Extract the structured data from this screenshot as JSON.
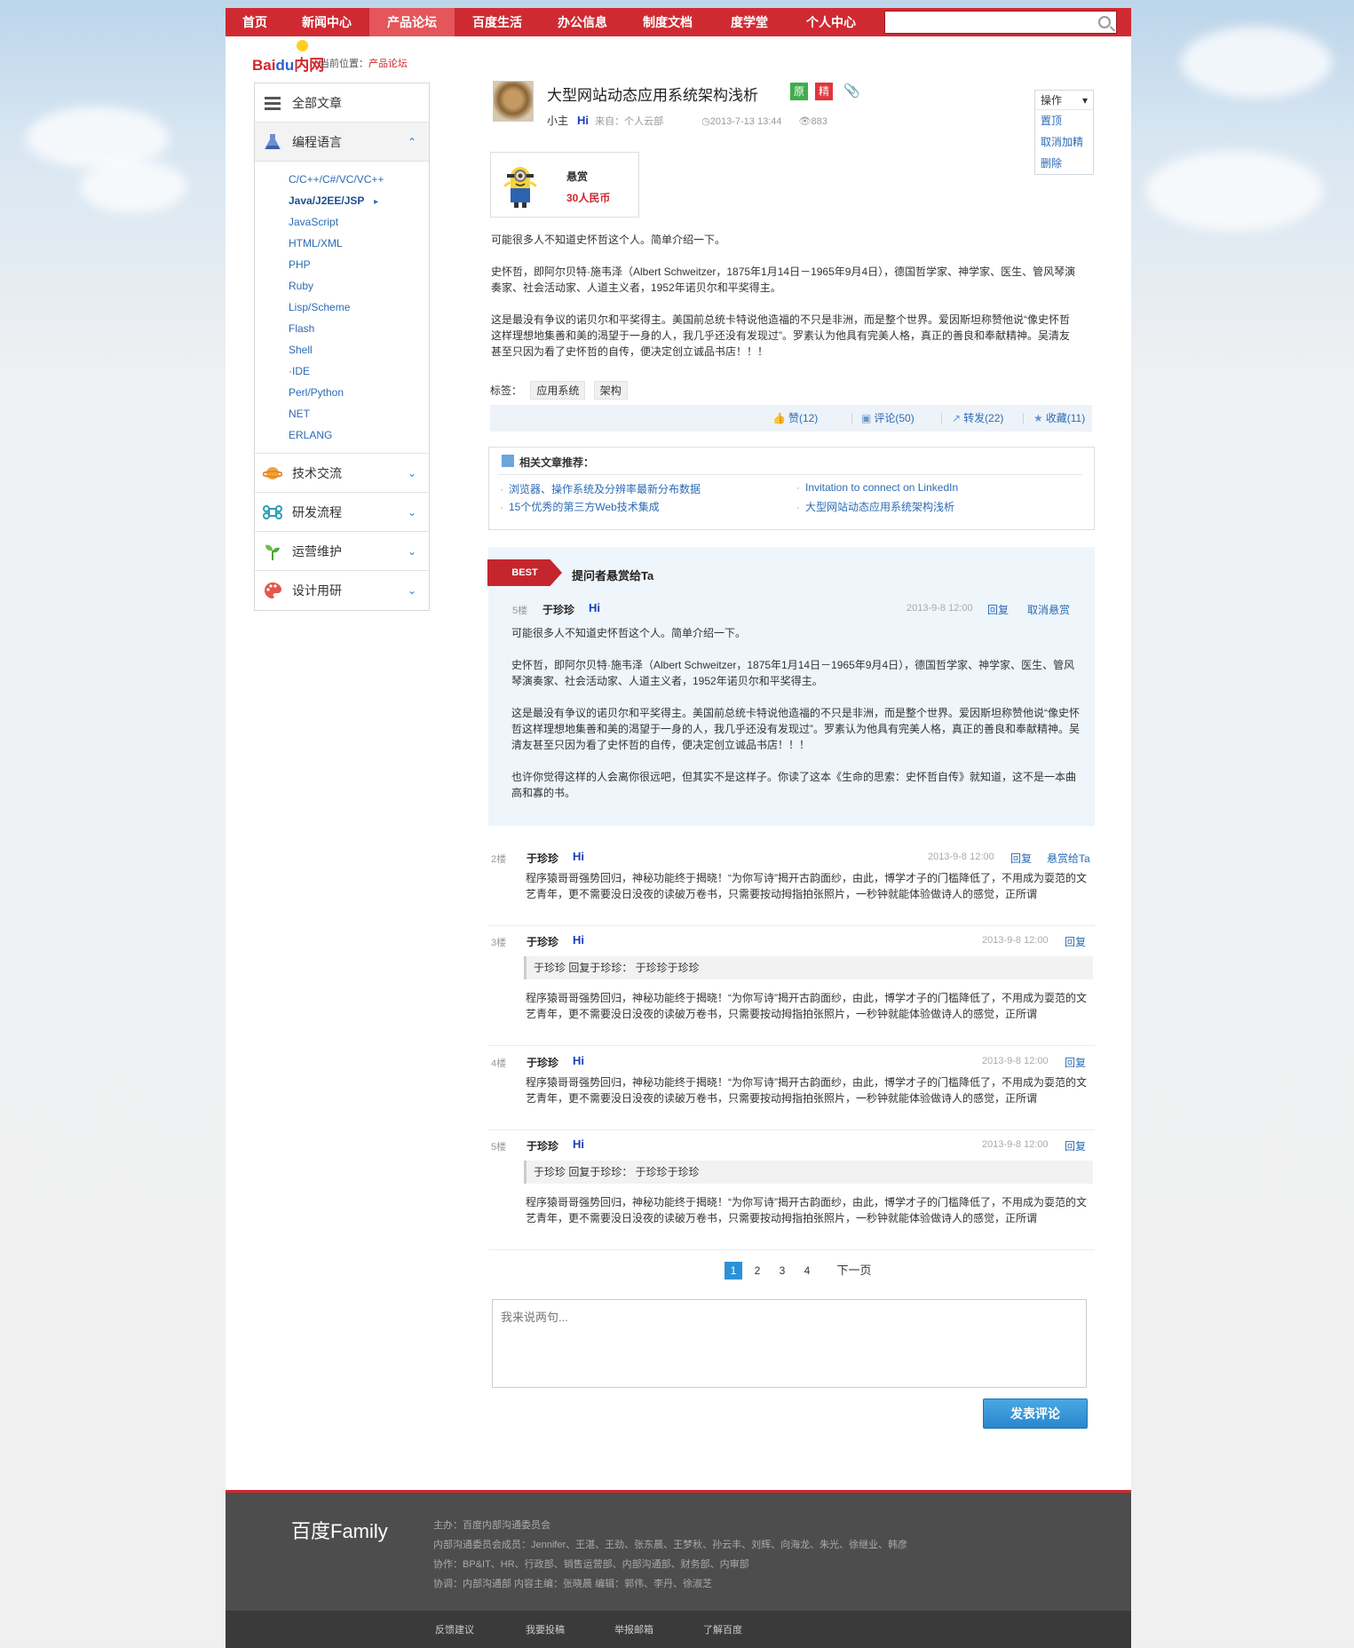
{
  "nav": {
    "items": [
      "首页",
      "新闻中心",
      "产品论坛",
      "百度生活",
      "办公信息",
      "制度文档",
      "度学堂",
      "个人中心"
    ],
    "active": "产品论坛",
    "search_value": ""
  },
  "logo": {
    "part1": "Bai",
    "part2": "du",
    "part3": "内网"
  },
  "breadcrumb": {
    "label": "当前位置：",
    "current": "产品论坛"
  },
  "sidebar": {
    "all": "全部文章",
    "lang": "编程语言",
    "lang_items": [
      "C/C++/C#/VC/VC++",
      "Java/J2EE/JSP",
      "JavaScript",
      "HTML/XML",
      "PHP",
      "Ruby",
      "Lisp/Scheme",
      "Flash",
      "Shell",
      "·IDE",
      "Perl/Python",
      "NET",
      "ERLANG"
    ],
    "selected": "Java/J2EE/JSP",
    "tech": "技术交流",
    "flow": "研发流程",
    "ops": "运营维护",
    "design": "设计用研"
  },
  "article": {
    "title": "大型网站动态应用系统架构浅析",
    "badge_original": "原",
    "badge_featured": "精",
    "author": "小主",
    "hi": "Hi",
    "source": "来自：个人云部",
    "time": "2013-7-13 13:44",
    "views": "883",
    "reward_label": "悬赏",
    "reward_value": "30人民币",
    "p1": "可能很多人不知道史怀哲这个人。简单介绍一下。",
    "p2": "史怀哲，即阿尔贝特·施韦泽（Albert Schweitzer，1875年1月14日－1965年9月4日），德国哲学家、神学家、医生、管风琴演奏家、社会活动家、人道主义者，1952年诺贝尔和平奖得主。",
    "p3": "这是最没有争议的诺贝尔和平奖得主。美国前总统卡特说他造福的不只是非洲，而是整个世界。爱因斯坦称赞他说“像史怀哲这样理想地集善和美的渴望于一身的人，我几乎还没有发现过”。罗素认为他具有完美人格，真正的善良和奉献精神。吴清友甚至只因为看了史怀哲的自传，便决定创立诚品书店！！！",
    "tags_label": "标签：",
    "tags": [
      "应用系统",
      "架构"
    ],
    "like": "赞(12)",
    "comment": "评论(50)",
    "forward": "转发(22)",
    "fav": "收藏(11)"
  },
  "ops_menu": {
    "head": "操作",
    "items": [
      "置顶",
      "取消加精",
      "删除"
    ]
  },
  "related": {
    "title": "相关文章推荐：",
    "links": [
      "浏览器、操作系统及分辨率最新分布数据",
      "Invitation to connect on LinkedIn",
      "15个优秀的第三方Web技术集成",
      "大型网站动态应用系统架构浅析"
    ]
  },
  "best": {
    "ribbon": "BEST",
    "title": "提问者悬赏给Ta",
    "floor": "5楼",
    "user": "于珍珍",
    "hi": "Hi",
    "date": "2013-9-8 12:00",
    "reply": "回复",
    "cancel": "取消悬赏",
    "p1": "可能很多人不知道史怀哲这个人。简单介绍一下。",
    "p2": "史怀哲，即阿尔贝特·施韦泽（Albert Schweitzer，1875年1月14日－1965年9月4日），德国哲学家、神学家、医生、管风琴演奏家、社会活动家、人道主义者，1952年诺贝尔和平奖得主。",
    "p3": "这是最没有争议的诺贝尔和平奖得主。美国前总统卡特说他造福的不只是非洲，而是整个世界。爱因斯坦称赞他说“像史怀哲这样理想地集善和美的渴望于一身的人，我几乎还没有发现过”。罗素认为他具有完美人格，真正的善良和奉献精神。吴清友甚至只因为看了史怀哲的自传，便决定创立诚品书店！！！",
    "p4": "也许你觉得这样的人会离你很远吧，但其实不是这样子。你读了这本《生命的思索：史怀哲自传》就知道，这不是一本曲高和寡的书。"
  },
  "replies": [
    {
      "floor": "2楼",
      "user": "于珍珍",
      "hi": "Hi",
      "date": "2013-9-8 12:00",
      "reply": "回复",
      "extra": "悬赏给Ta",
      "quote": "",
      "text": "程序猿哥哥强势回归，神秘功能终于揭晓！“为你写诗”揭开古韵面纱，由此，博学才子的门槛降低了，不用成为耍范的文艺青年，更不需要没日没夜的读破万卷书，只需要按动拇指拍张照片，一秒钟就能体验做诗人的感觉，正所谓"
    },
    {
      "floor": "3楼",
      "user": "于珍珍",
      "hi": "Hi",
      "date": "2013-9-8 12:00",
      "reply": "回复",
      "extra": "",
      "quote": "于珍珍    回复于珍珍：    于珍珍于珍珍",
      "text": "程序猿哥哥强势回归，神秘功能终于揭晓！“为你写诗”揭开古韵面纱，由此，博学才子的门槛降低了，不用成为耍范的文艺青年，更不需要没日没夜的读破万卷书，只需要按动拇指拍张照片，一秒钟就能体验做诗人的感觉，正所谓"
    },
    {
      "floor": "4楼",
      "user": "于珍珍",
      "hi": "Hi",
      "date": "2013-9-8 12:00",
      "reply": "回复",
      "extra": "",
      "quote": "",
      "text": "程序猿哥哥强势回归，神秘功能终于揭晓！“为你写诗”揭开古韵面纱，由此，博学才子的门槛降低了，不用成为耍范的文艺青年，更不需要没日没夜的读破万卷书，只需要按动拇指拍张照片，一秒钟就能体验做诗人的感觉，正所谓"
    },
    {
      "floor": "5楼",
      "user": "于珍珍",
      "hi": "Hi",
      "date": "2013-9-8 12:00",
      "reply": "回复",
      "extra": "",
      "quote": "于珍珍    回复于珍珍：    于珍珍于珍珍",
      "text": "程序猿哥哥强势回归，神秘功能终于揭晓！“为你写诗”揭开古韵面纱，由此，博学才子的门槛降低了，不用成为耍范的文艺青年，更不需要没日没夜的读破万卷书，只需要按动拇指拍张照片，一秒钟就能体验做诗人的感觉，正所谓"
    }
  ],
  "pager": {
    "pages": [
      "1",
      "2",
      "3",
      "4"
    ],
    "current": "1",
    "next": "下一页"
  },
  "comment": {
    "placeholder": "我来说两句...",
    "submit": "发表评论"
  },
  "footer": {
    "logo": "百度Family",
    "lines": [
      "主办：百度内部沟通委员会",
      "内部沟通委员会成员：Jennifer、王湛、王劲、张东晨、王梦秋、孙云丰、刘辉、向海龙、朱光、徐继业、韩彦",
      "协作：BP&IT、HR、行政部、销售运营部、内部沟通部、财务部、内审部",
      "协调：内部沟通部 内容主编：张晓晨 编辑：郭伟、李丹、徐淑芝"
    ],
    "links": [
      "反馈建议",
      "我要投稿",
      "举报邮箱",
      "了解百度"
    ]
  },
  "colors": {
    "brand_red": "#cf2a32",
    "link_blue": "#2b6bb5",
    "best_bg": "#eef5fb"
  }
}
